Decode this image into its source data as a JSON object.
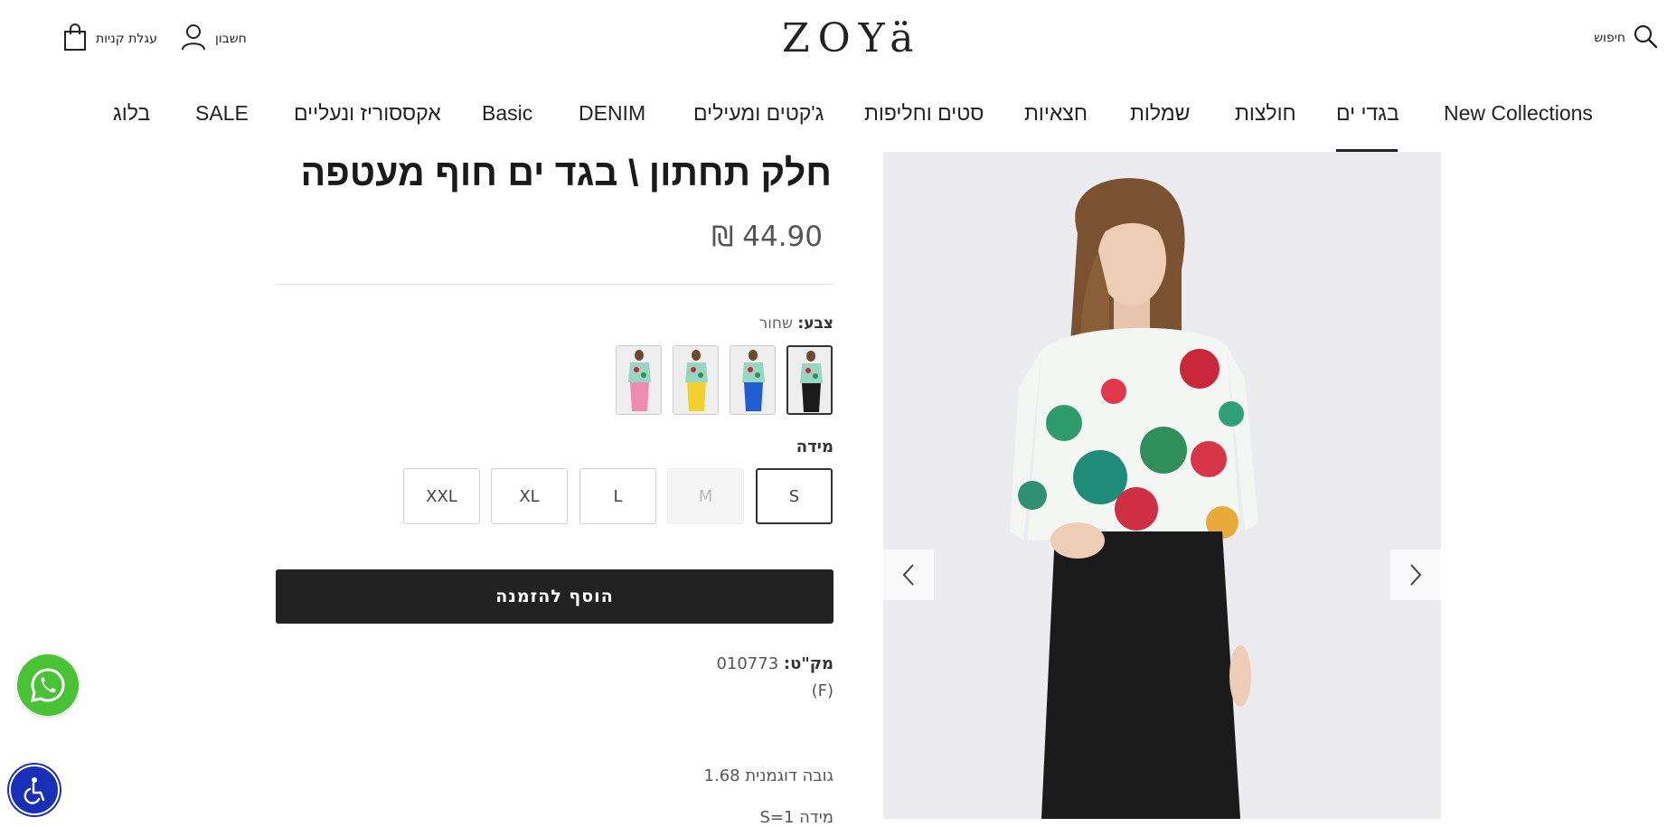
{
  "header": {
    "search_label": "חיפוש",
    "logo_text": "ZOYä",
    "account_label": "חשבון",
    "cart_label": "עגלת קניות",
    "icons": {
      "search": "search-icon",
      "account": "user-icon",
      "cart": "shopping-bag-icon"
    }
  },
  "nav": {
    "items": [
      {
        "label": "New Collections"
      },
      {
        "label": "בגדי ים",
        "active": true
      },
      {
        "label": "חולצות"
      },
      {
        "label": "שמלות"
      },
      {
        "label": "חצאיות"
      },
      {
        "label": "סטים וחליפות"
      },
      {
        "label": "ג'קטים ומעילים"
      },
      {
        "label": "DENIM"
      },
      {
        "label": "Basic"
      },
      {
        "label": "אקססוריז ונעליים"
      },
      {
        "label": "SALE"
      },
      {
        "label": "בלוג"
      }
    ]
  },
  "product": {
    "title": "חלק תחתון \\ בגד ים חוף מעטפה",
    "price": "44.90 ₪",
    "color_label": "צבע:",
    "color_value": "שחור",
    "swatches": [
      {
        "name": "שחור",
        "skirt_color": "#1b1b1b",
        "selected": true
      },
      {
        "name": "כחול",
        "skirt_color": "#1f5fd1",
        "selected": false
      },
      {
        "name": "צהוב",
        "skirt_color": "#f2d030",
        "selected": false
      },
      {
        "name": "ורוד",
        "skirt_color": "#f08bb0",
        "selected": false
      }
    ],
    "size_label": "מידה",
    "sizes": [
      {
        "label": "S",
        "selected": true,
        "disabled": false
      },
      {
        "label": "M",
        "selected": false,
        "disabled": true
      },
      {
        "label": "L",
        "selected": false,
        "disabled": false
      },
      {
        "label": "XL",
        "selected": false,
        "disabled": false
      },
      {
        "label": "XXL",
        "selected": false,
        "disabled": false
      }
    ],
    "add_to_cart": "הוסף להזמנה",
    "sku_label": "מק\"ט:",
    "sku_value": "010773",
    "sku_sub": "(F)",
    "model_height": "גובה דוגמנית 1.68",
    "model_size": "מידה S=1"
  },
  "colors": {
    "whatsapp": "#4ac236",
    "accessibility": "#1a2fb8",
    "primary_button": "#222222"
  }
}
